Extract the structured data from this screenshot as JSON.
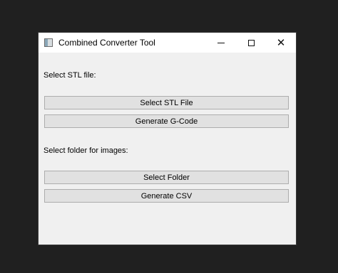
{
  "window": {
    "title": "Combined Converter Tool",
    "controls": {
      "close_glyph": "✕"
    }
  },
  "stl_section": {
    "label": "Select STL file:",
    "select_button": "Select STL File",
    "generate_button": "Generate G-Code"
  },
  "image_section": {
    "label": "Select folder for images:",
    "select_button": "Select Folder",
    "generate_button": "Generate CSV"
  },
  "icons": {
    "app": "app-icon",
    "minimize": "minimize-icon",
    "maximize": "maximize-icon",
    "close": "close-icon"
  }
}
